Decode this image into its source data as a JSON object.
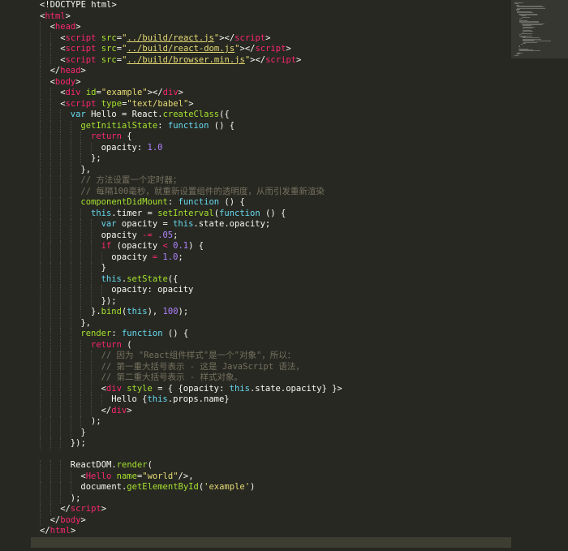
{
  "editor": {
    "lines": [
      {
        "n": "1",
        "indent": 0,
        "parts": [
          [
            "pl",
            "<!DOCTYPE html>"
          ]
        ]
      },
      {
        "n": "2",
        "indent": 0,
        "parts": [
          [
            "pl",
            "<"
          ],
          [
            "tag",
            "html"
          ],
          [
            "pl",
            ">"
          ]
        ]
      },
      {
        "n": "3",
        "indent": 1,
        "parts": [
          [
            "pl",
            "<"
          ],
          [
            "tag",
            "head"
          ],
          [
            "pl",
            ">"
          ]
        ]
      },
      {
        "n": "4",
        "indent": 2,
        "parts": [
          [
            "pl",
            "<"
          ],
          [
            "tag",
            "script"
          ],
          [
            "pl",
            " "
          ],
          [
            "att",
            "src"
          ],
          [
            "pl",
            "="
          ],
          [
            "str",
            "\""
          ],
          [
            "strp",
            "../build/react.js"
          ],
          [
            "str",
            "\""
          ],
          [
            "pl",
            "></"
          ],
          [
            "tag",
            "script"
          ],
          [
            "pl",
            ">"
          ]
        ]
      },
      {
        "n": "5",
        "indent": 2,
        "parts": [
          [
            "pl",
            "<"
          ],
          [
            "tag",
            "script"
          ],
          [
            "pl",
            " "
          ],
          [
            "att",
            "src"
          ],
          [
            "pl",
            "="
          ],
          [
            "str",
            "\""
          ],
          [
            "strp",
            "../build/react-dom.js"
          ],
          [
            "str",
            "\""
          ],
          [
            "pl",
            "></"
          ],
          [
            "tag",
            "script"
          ],
          [
            "pl",
            ">"
          ]
        ]
      },
      {
        "n": "6",
        "indent": 2,
        "parts": [
          [
            "pl",
            "<"
          ],
          [
            "tag",
            "script"
          ],
          [
            "pl",
            " "
          ],
          [
            "att",
            "src"
          ],
          [
            "pl",
            "="
          ],
          [
            "str",
            "\""
          ],
          [
            "strp",
            "../build/browser.min.js"
          ],
          [
            "str",
            "\""
          ],
          [
            "pl",
            "></"
          ],
          [
            "tag",
            "script"
          ],
          [
            "pl",
            ">"
          ]
        ]
      },
      {
        "n": "7",
        "indent": 1,
        "parts": [
          [
            "pl",
            "</"
          ],
          [
            "tag",
            "head"
          ],
          [
            "pl",
            ">"
          ]
        ]
      },
      {
        "n": "8",
        "indent": 1,
        "parts": [
          [
            "pl",
            "<"
          ],
          [
            "tag",
            "body"
          ],
          [
            "pl",
            ">"
          ]
        ]
      },
      {
        "n": "9",
        "indent": 2,
        "parts": [
          [
            "pl",
            "<"
          ],
          [
            "tag",
            "div"
          ],
          [
            "pl",
            " "
          ],
          [
            "att",
            "id"
          ],
          [
            "pl",
            "="
          ],
          [
            "str",
            "\"example\""
          ],
          [
            "pl",
            "></"
          ],
          [
            "tag",
            "div"
          ],
          [
            "pl",
            ">"
          ]
        ]
      },
      {
        "n": "10",
        "indent": 2,
        "parts": [
          [
            "pl",
            "<"
          ],
          [
            "tag",
            "script"
          ],
          [
            "pl",
            " "
          ],
          [
            "att",
            "type"
          ],
          [
            "pl",
            "="
          ],
          [
            "str",
            "\"text/babel\""
          ],
          [
            "pl",
            ">"
          ]
        ]
      },
      {
        "n": "11",
        "indent": 3,
        "parts": [
          [
            "sg",
            "var"
          ],
          [
            "pl",
            " Hello = React."
          ],
          [
            "fn",
            "createClass"
          ],
          [
            "pl",
            "({"
          ]
        ]
      },
      {
        "n": "12",
        "indent": 4,
        "parts": [
          [
            "fn",
            "getInitialState"
          ],
          [
            "pl",
            ": "
          ],
          [
            "sg",
            "function"
          ],
          [
            "pl",
            " () {"
          ]
        ]
      },
      {
        "n": "13",
        "indent": 5,
        "parts": [
          [
            "kw",
            "return"
          ],
          [
            "pl",
            " {"
          ]
        ]
      },
      {
        "n": "14",
        "indent": 6,
        "parts": [
          [
            "pl",
            "opacity: "
          ],
          [
            "num",
            "1.0"
          ]
        ]
      },
      {
        "n": "15",
        "indent": 5,
        "parts": [
          [
            "pl",
            "};"
          ]
        ]
      },
      {
        "n": "16",
        "indent": 4,
        "parts": [
          [
            "pl",
            "},"
          ]
        ]
      },
      {
        "n": "17",
        "indent": 4,
        "parts": [
          [
            "cm",
            "// 方法设置一个定时器；"
          ]
        ]
      },
      {
        "n": "18",
        "indent": 4,
        "parts": [
          [
            "cm",
            "// 每隔100毫秒，就重新设置组件的透明度，从而引发重新渲染"
          ]
        ]
      },
      {
        "n": "19",
        "indent": 4,
        "parts": [
          [
            "fn",
            "componentDidMount"
          ],
          [
            "pl",
            ": "
          ],
          [
            "sg",
            "function"
          ],
          [
            "pl",
            " () {"
          ]
        ]
      },
      {
        "n": "20",
        "indent": 5,
        "parts": [
          [
            "this",
            "this"
          ],
          [
            "pl",
            ".timer = "
          ],
          [
            "fn",
            "setInterval"
          ],
          [
            "pl",
            "("
          ],
          [
            "sg",
            "function"
          ],
          [
            "pl",
            " () {"
          ]
        ]
      },
      {
        "n": "21",
        "indent": 6,
        "parts": [
          [
            "sg",
            "var"
          ],
          [
            "pl",
            " opacity = "
          ],
          [
            "this",
            "this"
          ],
          [
            "pl",
            ".state.opacity;"
          ]
        ]
      },
      {
        "n": "22",
        "indent": 6,
        "parts": [
          [
            "pl",
            "opacity "
          ],
          [
            "kw",
            "-="
          ],
          [
            "pl",
            " "
          ],
          [
            "num",
            ".05"
          ],
          [
            "pl",
            ";"
          ]
        ]
      },
      {
        "n": "23",
        "indent": 6,
        "parts": [
          [
            "kw",
            "if"
          ],
          [
            "pl",
            " (opacity "
          ],
          [
            "kw",
            "<"
          ],
          [
            "pl",
            " "
          ],
          [
            "num",
            "0.1"
          ],
          [
            "pl",
            ") {"
          ]
        ]
      },
      {
        "n": "24",
        "indent": 7,
        "parts": [
          [
            "pl",
            "opacity "
          ],
          [
            "kw",
            "="
          ],
          [
            "pl",
            " "
          ],
          [
            "num",
            "1.0"
          ],
          [
            "pl",
            ";"
          ]
        ]
      },
      {
        "n": "25",
        "indent": 6,
        "parts": [
          [
            "pl",
            "}"
          ]
        ]
      },
      {
        "n": "26",
        "indent": 6,
        "parts": [
          [
            "this",
            "this"
          ],
          [
            "pl",
            "."
          ],
          [
            "fn",
            "setState"
          ],
          [
            "pl",
            "({"
          ]
        ]
      },
      {
        "n": "27",
        "indent": 7,
        "parts": [
          [
            "pl",
            "opacity: opacity"
          ]
        ]
      },
      {
        "n": "28",
        "indent": 6,
        "parts": [
          [
            "pl",
            "});"
          ]
        ]
      },
      {
        "n": "29",
        "indent": 5,
        "parts": [
          [
            "pl",
            "}."
          ],
          [
            "fn",
            "bind"
          ],
          [
            "pl",
            "("
          ],
          [
            "this",
            "this"
          ],
          [
            "pl",
            "), "
          ],
          [
            "num",
            "100"
          ],
          [
            "pl",
            ");"
          ]
        ]
      },
      {
        "n": "30",
        "indent": 4,
        "parts": [
          [
            "pl",
            "},"
          ]
        ]
      },
      {
        "n": "31",
        "indent": 4,
        "parts": [
          [
            "fn",
            "render"
          ],
          [
            "pl",
            ": "
          ],
          [
            "sg",
            "function"
          ],
          [
            "pl",
            " () {"
          ]
        ]
      },
      {
        "n": "32",
        "indent": 5,
        "parts": [
          [
            "kw",
            "return"
          ],
          [
            "pl",
            " ("
          ]
        ]
      },
      {
        "n": "33",
        "indent": 6,
        "parts": [
          [
            "cm",
            "// 因为 \"React组件样式\"是一个\"对象\"，所以："
          ]
        ]
      },
      {
        "n": "34",
        "indent": 6,
        "parts": [
          [
            "cm",
            "// 第一重大括号表示 - 这是 JavaScript 语法，"
          ]
        ]
      },
      {
        "n": "35",
        "indent": 6,
        "parts": [
          [
            "cm",
            "// 第二重大括号表示 - 样式对象。"
          ]
        ]
      },
      {
        "n": "36",
        "indent": 6,
        "parts": [
          [
            "pl",
            "<"
          ],
          [
            "tag",
            "div"
          ],
          [
            "pl",
            " "
          ],
          [
            "att",
            "style"
          ],
          [
            "pl",
            " = { {opacity: "
          ],
          [
            "this",
            "this"
          ],
          [
            "pl",
            ".state.opacity} }>"
          ]
        ]
      },
      {
        "n": "37",
        "indent": 7,
        "parts": [
          [
            "pl",
            "Hello {"
          ],
          [
            "this",
            "this"
          ],
          [
            "pl",
            ".props.name}"
          ]
        ]
      },
      {
        "n": "38",
        "indent": 6,
        "parts": [
          [
            "pl",
            "</"
          ],
          [
            "tag",
            "div"
          ],
          [
            "pl",
            ">"
          ]
        ]
      },
      {
        "n": "39",
        "indent": 5,
        "parts": [
          [
            "pl",
            ");"
          ]
        ]
      },
      {
        "n": "40",
        "indent": 4,
        "parts": [
          [
            "pl",
            "}"
          ]
        ]
      },
      {
        "n": "41",
        "indent": 3,
        "parts": [
          [
            "pl",
            "});"
          ]
        ]
      },
      {
        "n": "42",
        "indent": 0,
        "parts": []
      },
      {
        "n": "43",
        "indent": 3,
        "parts": [
          [
            "pl",
            "ReactDOM."
          ],
          [
            "fn",
            "render"
          ],
          [
            "pl",
            "("
          ]
        ]
      },
      {
        "n": "44",
        "indent": 4,
        "parts": [
          [
            "pl",
            "<"
          ],
          [
            "tag",
            "Hello"
          ],
          [
            "pl",
            " "
          ],
          [
            "att",
            "name"
          ],
          [
            "pl",
            "="
          ],
          [
            "str",
            "\"world\""
          ],
          [
            "pl",
            "/>,"
          ]
        ]
      },
      {
        "n": "45",
        "indent": 4,
        "parts": [
          [
            "pl",
            "document."
          ],
          [
            "fn",
            "getElementById"
          ],
          [
            "pl",
            "("
          ],
          [
            "str",
            "'example'"
          ],
          [
            "pl",
            ")"
          ]
        ]
      },
      {
        "n": "46",
        "indent": 3,
        "parts": [
          [
            "pl",
            ");"
          ]
        ]
      },
      {
        "n": "47",
        "indent": 2,
        "parts": [
          [
            "pl",
            "</"
          ],
          [
            "tag",
            "script"
          ],
          [
            "pl",
            ">"
          ]
        ]
      },
      {
        "n": "48",
        "indent": 1,
        "parts": [
          [
            "pl",
            "</"
          ],
          [
            "tag",
            "body"
          ],
          [
            "pl",
            ">"
          ]
        ]
      },
      {
        "n": "49",
        "indent": 0,
        "parts": [
          [
            "pl",
            "</"
          ],
          [
            "tag",
            "html"
          ],
          [
            "pl",
            ">"
          ]
        ]
      },
      {
        "n": "50",
        "indent": 0,
        "parts": []
      }
    ]
  }
}
